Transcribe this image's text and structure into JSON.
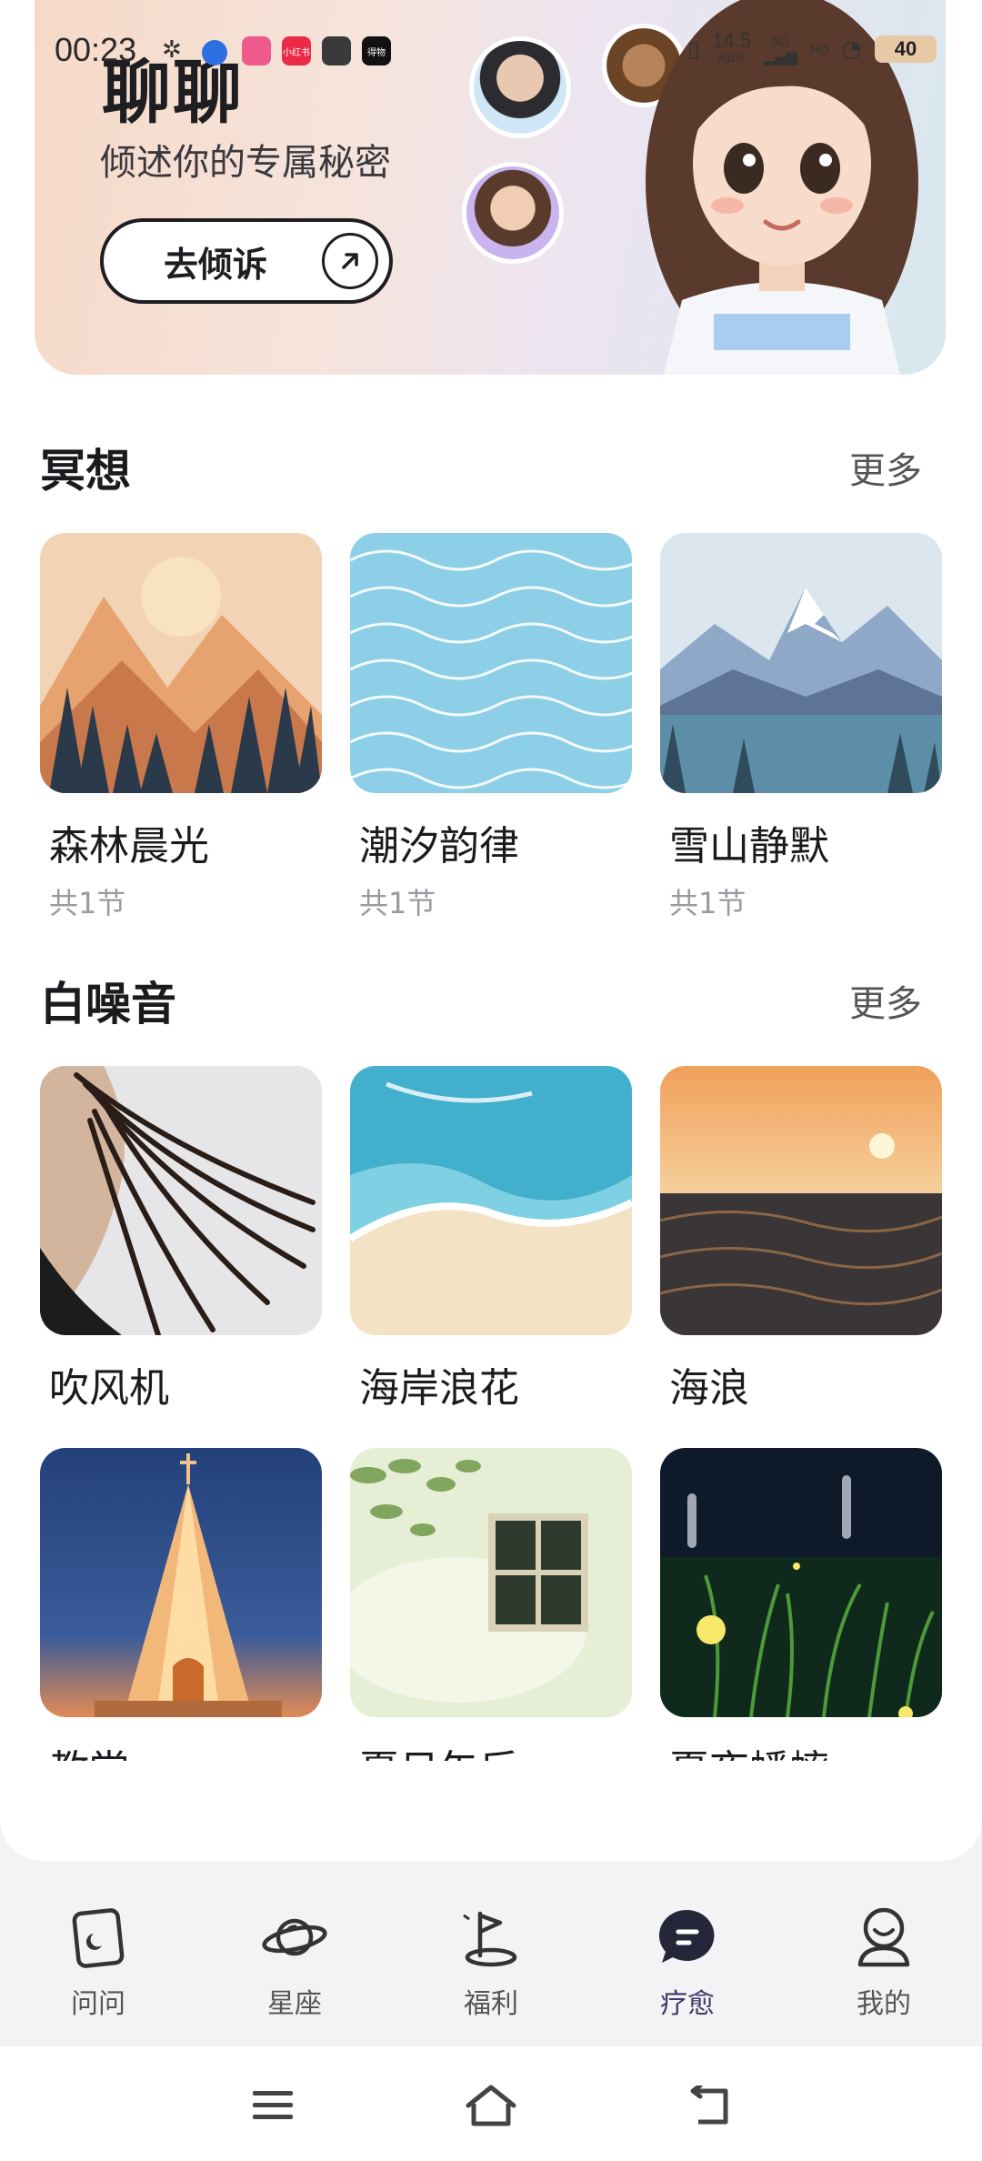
{
  "status_bar": {
    "time": "00:23",
    "net_speed_value": "14.5",
    "net_speed_unit": "KB/s",
    "signal_label": "5G",
    "hd_label": "HD",
    "battery": "40",
    "app_icon_labels": [
      "小红书",
      "得物"
    ]
  },
  "hero": {
    "title": "聊聊",
    "subtitle": "倾述你的专属秘密",
    "button_label": "去倾诉"
  },
  "meditation": {
    "title": "冥想",
    "more": "更多",
    "items": [
      {
        "title": "森林晨光",
        "sub": "共1节"
      },
      {
        "title": "潮汐韵律",
        "sub": "共1节"
      },
      {
        "title": "雪山静默",
        "sub": "共1节"
      }
    ]
  },
  "white_noise": {
    "title": "白噪音",
    "more": "更多",
    "items": [
      {
        "title": "吹风机"
      },
      {
        "title": "海岸浪花"
      },
      {
        "title": "海浪"
      },
      {
        "title": "教堂"
      },
      {
        "title": "夏日午后"
      },
      {
        "title": "夏夜蟋蟀"
      }
    ]
  },
  "tabs": [
    {
      "label": "问问",
      "icon": "card-icon"
    },
    {
      "label": "星座",
      "icon": "planet-icon"
    },
    {
      "label": "福利",
      "icon": "flag-icon"
    },
    {
      "label": "疗愈",
      "icon": "chat-bubble-icon",
      "active": true
    },
    {
      "label": "我的",
      "icon": "user-icon"
    }
  ],
  "colors": {
    "accent": "#3c3a67",
    "text": "#1b1b1f",
    "muted": "#9a9aa0"
  }
}
